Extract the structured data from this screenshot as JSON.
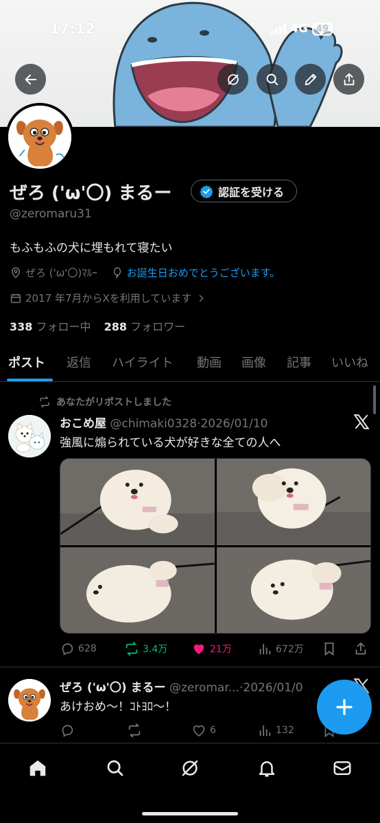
{
  "status_bar": {
    "time": "17:12",
    "network": "4G",
    "battery": "49"
  },
  "header": {
    "back_icon": "arrow-left-icon",
    "grok_icon": "grok-icon",
    "search_icon": "search-icon",
    "edit_icon": "pencil-icon",
    "share_icon": "share-icon"
  },
  "profile": {
    "display_name": "ぜろ ('ω'〇) まるー",
    "verify_button": "認証を受ける",
    "handle": "@zeromaru31",
    "bio": "もふもふの犬に埋もれて寝たい",
    "location": "ぜろ ('ω'〇)ﾏﾙｰ",
    "birthday": "お誕生日おめでとうございます。",
    "joined": "2017 年7月からXを利用しています",
    "following_count": "338",
    "following_label": "フォロー中",
    "followers_count": "288",
    "followers_label": "フォロワー"
  },
  "tabs": [
    "ポスト",
    "返信",
    "ハイライト",
    "動画",
    "画像",
    "記事",
    "いいね"
  ],
  "tweets": [
    {
      "repost_label": "あなたがリポストしました",
      "display_name": "おこめ屋",
      "handle": "@chimaki0328",
      "date": "2026/01/10",
      "text": "強風に煽られている犬が好きな全ての人へ",
      "replies": "628",
      "reposts": "3.4万",
      "likes": "21万",
      "views": "672万"
    },
    {
      "display_name": "ぜろ ('ω'〇) まるー",
      "handle": "@zeromar...",
      "date": "2026/01/0",
      "text": "あけおめ〜！ｺﾄﾖﾛ〜！",
      "replies": "",
      "reposts": "",
      "likes": "6",
      "views": "132"
    }
  ],
  "colors": {
    "accent": "#1d9bf0",
    "like": "#f91880",
    "repost": "#00ba7c",
    "muted": "#71767b"
  },
  "bottom_nav": [
    "home-icon",
    "search-icon",
    "grok-icon",
    "notifications-icon",
    "messages-icon"
  ]
}
